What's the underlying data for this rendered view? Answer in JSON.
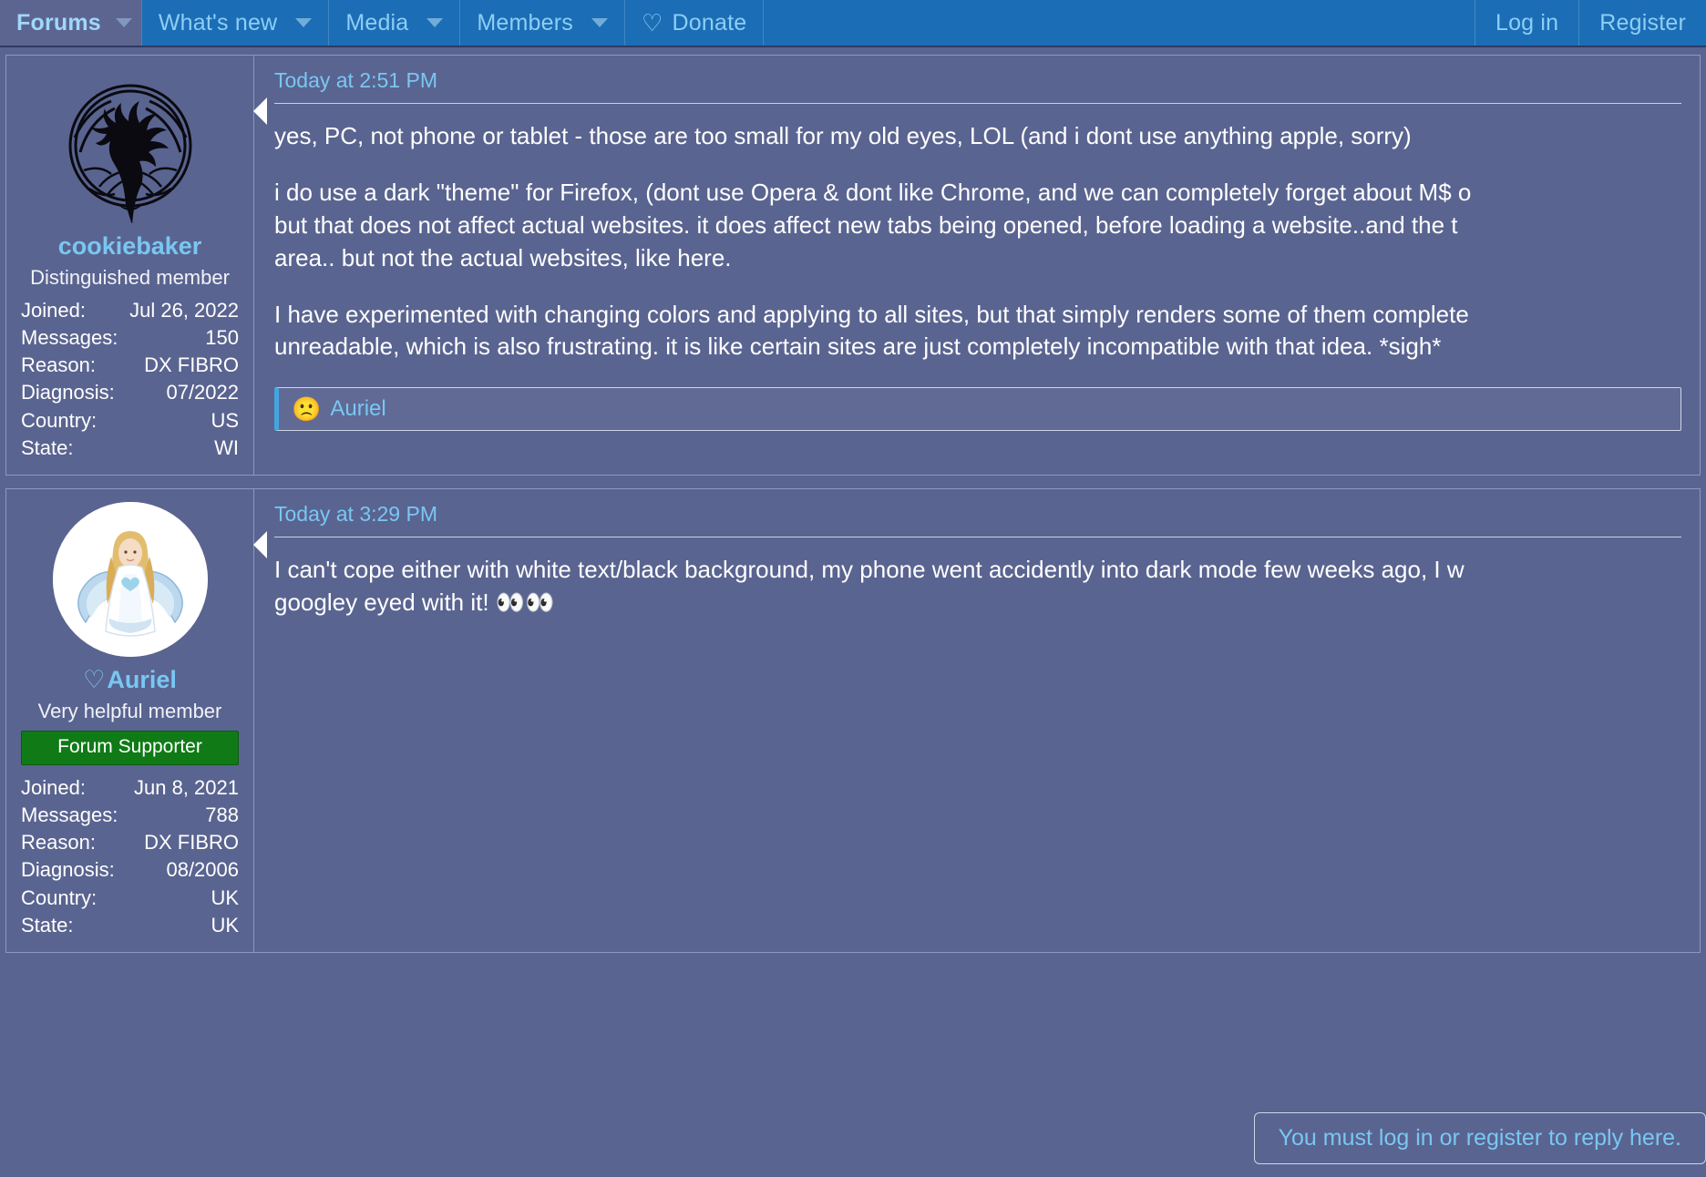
{
  "navbar": {
    "items": [
      {
        "label": "Forums",
        "icon": "chevron-down-icon",
        "has_caret": true,
        "active": true
      },
      {
        "label": "What's new",
        "icon": "chevron-down-icon",
        "has_caret": true,
        "active": false
      },
      {
        "label": "Media",
        "icon": "chevron-down-icon",
        "has_caret": true,
        "active": false
      },
      {
        "label": "Members",
        "icon": "chevron-down-icon",
        "has_caret": true,
        "active": false
      },
      {
        "label": "Donate",
        "icon": "heart-outline-icon",
        "has_caret": false,
        "active": false
      }
    ],
    "heart_glyph": "♡",
    "auth": {
      "log_in": "Log in",
      "register": "Register"
    },
    "colors": {
      "bar_bg": "#1b6eb5",
      "active_bg": "#5c6590",
      "link": "#8ecdf5"
    }
  },
  "posts": [
    {
      "date": "Today at 2:51 PM",
      "user": {
        "name": "cookiebaker",
        "name_prefix": "",
        "title": "Distinguished member",
        "banner": null,
        "avatar": "tree-of-life-avatar",
        "stats": [
          {
            "key": "Joined:",
            "value": "Jul 26, 2022"
          },
          {
            "key": "Messages:",
            "value": "150"
          },
          {
            "key": "Reason:",
            "value": "DX FIBRO"
          },
          {
            "key": "Diagnosis:",
            "value": "07/2022"
          },
          {
            "key": "Country:",
            "value": "US"
          },
          {
            "key": "State:",
            "value": "WI"
          }
        ]
      },
      "paragraphs": [
        "yes, PC, not phone or tablet - those are too small for my old eyes, LOL (and i dont use anything apple, sorry)",
        "i do use a dark \"theme\" for Firefox, (dont use Opera & dont like Chrome, and we can completely forget about M$ o\nbut that does not affect actual websites. it does affect new tabs being opened, before loading a website..and the t\narea.. but not the actual websites, like here.",
        "I have experimented with changing colors and applying to all sites, but that simply renders some of them complete\nunreadable, which is also frustrating. it is like certain sites are just completely incompatible with that idea. *sigh*"
      ],
      "reaction": {
        "emoji": "🙁",
        "emoji_name": "slightly-frowning-face",
        "users": "Auriel"
      }
    },
    {
      "date": "Today at 3:29 PM",
      "user": {
        "name": "Auriel",
        "name_prefix": "♡",
        "title": "Very helpful member",
        "banner": "Forum Supporter",
        "banner_color": "#0f7a16",
        "avatar": "angel-avatar",
        "stats": [
          {
            "key": "Joined:",
            "value": "Jun 8, 2021"
          },
          {
            "key": "Messages:",
            "value": "788"
          },
          {
            "key": "Reason:",
            "value": "DX FIBRO"
          },
          {
            "key": "Diagnosis:",
            "value": "08/2006"
          },
          {
            "key": "Country:",
            "value": "UK"
          },
          {
            "key": "State:",
            "value": "UK"
          }
        ]
      },
      "paragraphs": [
        "I can't cope either with white text/black background, my phone went accidently into dark mode few weeks ago, I w\ngoogley eyed with it! 👀👀"
      ],
      "reaction": null
    }
  ],
  "footer": {
    "login_register": "You must log in or register to reply here."
  }
}
